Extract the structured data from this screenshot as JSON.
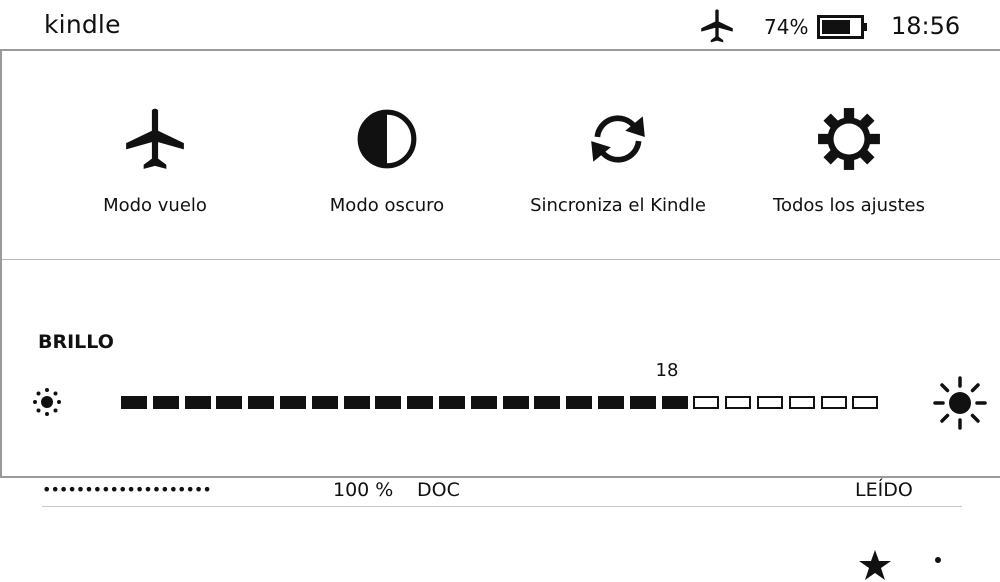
{
  "status_bar": {
    "app_title": "kindle",
    "airplane_icon": "airplane-icon",
    "battery_percent": "74%",
    "battery_level": 0.74,
    "time": "18:56"
  },
  "quick_actions": [
    {
      "label": "Modo vuelo",
      "icon": "airplane-icon"
    },
    {
      "label": "Modo oscuro",
      "icon": "contrast-icon"
    },
    {
      "label": "Sincroniza el Kindle",
      "icon": "sync-icon"
    },
    {
      "label": "Todos los ajustes",
      "icon": "gear-icon"
    }
  ],
  "brightness": {
    "title": "BRILLO",
    "value": "18",
    "level": 18,
    "max": 24,
    "min_icon": "sun-small-icon",
    "max_icon": "sun-large-icon"
  },
  "library_item": {
    "progress_dots": "••••••••••••••••••••",
    "percent": "100 %",
    "type": "DOC",
    "status": "LEÍDO",
    "icons": [
      "star-icon",
      "more-icon"
    ]
  },
  "colors": {
    "foreground": "#111111",
    "border": "#9a9a9a",
    "background": "#ffffff"
  }
}
